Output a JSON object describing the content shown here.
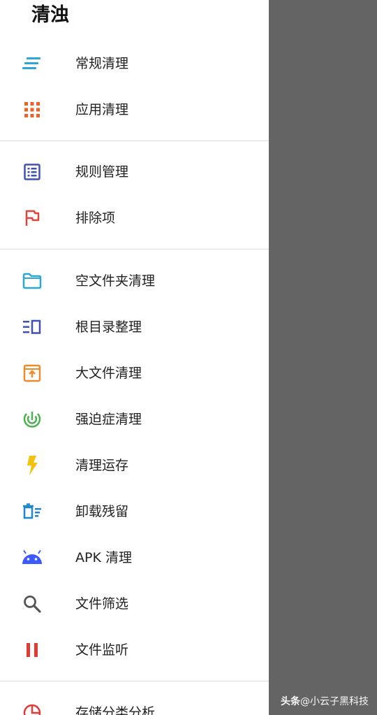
{
  "drawer": {
    "title": "清浊",
    "groups": [
      {
        "items": [
          {
            "label": "常规清理",
            "icon": "general-clean-icon",
            "color": "#2aa7d6"
          },
          {
            "label": "应用清理",
            "icon": "app-grid-icon",
            "color": "#e8622a"
          }
        ]
      },
      {
        "items": [
          {
            "label": "规则管理",
            "icon": "rules-list-icon",
            "color": "#3f51b5"
          },
          {
            "label": "排除项",
            "icon": "flag-icon",
            "color": "#e0453a"
          }
        ]
      },
      {
        "items": [
          {
            "label": "空文件夹清理",
            "icon": "folder-icon",
            "color": "#2aa7d6"
          },
          {
            "label": "根目录整理",
            "icon": "root-directory-icon",
            "color": "#3f51b5"
          },
          {
            "label": "大文件清理",
            "icon": "large-file-icon",
            "color": "#ef8a2b"
          },
          {
            "label": "强迫症清理",
            "icon": "ocd-target-icon",
            "color": "#4caf50"
          },
          {
            "label": "清理运存",
            "icon": "lightning-icon",
            "color": "#f4c20d"
          },
          {
            "label": "卸载残留",
            "icon": "uninstall-residue-icon",
            "color": "#1e88c9"
          },
          {
            "label": "APK 清理",
            "icon": "android-icon",
            "color": "#3d5afe"
          },
          {
            "label": "文件筛选",
            "icon": "search-icon",
            "color": "#555555"
          },
          {
            "label": "文件监听",
            "icon": "pause-icon",
            "color": "#e53935"
          }
        ]
      },
      {
        "items": [
          {
            "label": "存储分类分析",
            "icon": "pie-chart-icon",
            "color": "#e53935"
          }
        ]
      }
    ]
  },
  "watermark": {
    "brand": "头条",
    "handle": "@小云子黑科技"
  }
}
